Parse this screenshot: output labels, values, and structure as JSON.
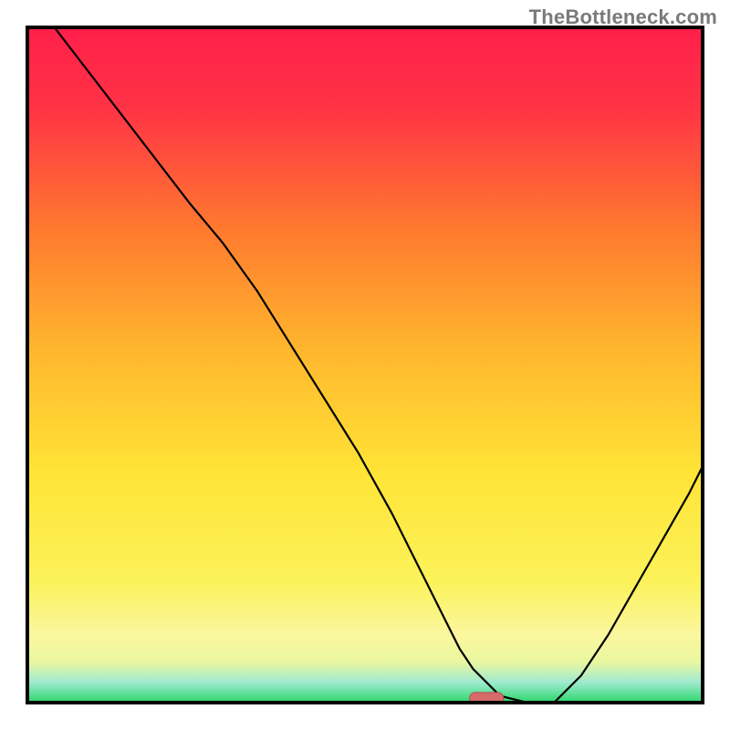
{
  "watermark": "TheBottleneck.com",
  "chart_data": {
    "type": "line",
    "title": "",
    "xlabel": "",
    "ylabel": "",
    "xlim": [
      0,
      100
    ],
    "ylim": [
      0,
      100
    ],
    "x": [
      4,
      14,
      24,
      29,
      34,
      39,
      44,
      49,
      54,
      57,
      60,
      62,
      64,
      66,
      68,
      70,
      74,
      78,
      82,
      86,
      90,
      94,
      98,
      100
    ],
    "values": [
      100,
      87,
      74,
      68,
      61,
      53,
      45,
      37,
      28,
      22,
      16,
      12,
      8,
      5,
      3,
      1,
      0,
      0,
      4,
      10,
      17,
      24,
      31,
      35
    ],
    "colors": {
      "gradient_top": "#ff1f4a",
      "gradient_mid_orange": "#ff8a2b",
      "gradient_mid_yellow": "#ffe436",
      "gradient_pale_yellow": "#fbf79e",
      "gradient_green": "#2bd66a",
      "border": "#000000",
      "curve": "#000000",
      "marker_fill": "#d66a6a",
      "marker_stroke": "#b94d4d"
    },
    "marker": {
      "x": 68,
      "y": 0.5,
      "width": 5,
      "height": 2
    }
  }
}
